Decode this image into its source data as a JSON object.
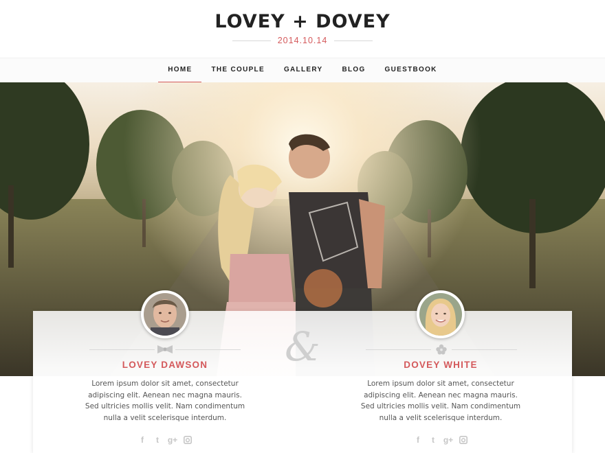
{
  "site": {
    "title": "LOVEY + DOVEY",
    "date": "2014.10.14"
  },
  "nav": {
    "items": [
      {
        "label": "HOME",
        "active": true
      },
      {
        "label": "THE COUPLE",
        "active": false
      },
      {
        "label": "GALLERY",
        "active": false
      },
      {
        "label": "BLOG",
        "active": false
      },
      {
        "label": "GUESTBOOK",
        "active": false
      }
    ]
  },
  "colors": {
    "accent": "#d4595b",
    "text": "#222222",
    "muted": "#c6c6c6"
  },
  "couple": {
    "ampersand": "&",
    "groom": {
      "name": "LOVEY DAWSON",
      "divider_icon": "bowtie-icon",
      "bio": "Lorem ipsum dolor sit amet, consectetur adipiscing elit. Aenean nec magna mauris. Sed ultricies mollis velit. Nam condimentum nulla a velit scelerisque interdum.",
      "social": [
        "facebook-icon",
        "twitter-icon",
        "google-plus-icon",
        "instagram-icon"
      ]
    },
    "bride": {
      "name": "DOVEY WHITE",
      "divider_icon": "flower-icon",
      "bio": "Lorem ipsum dolor sit amet, consectetur adipiscing elit. Aenean nec magna mauris. Sed ultricies mollis velit. Nam condimentum nulla a velit scelerisque interdum.",
      "social": [
        "facebook-icon",
        "twitter-icon",
        "google-plus-icon",
        "instagram-icon"
      ]
    }
  },
  "social_glyphs": {
    "facebook": "f",
    "twitter": "t",
    "google": "g+"
  }
}
